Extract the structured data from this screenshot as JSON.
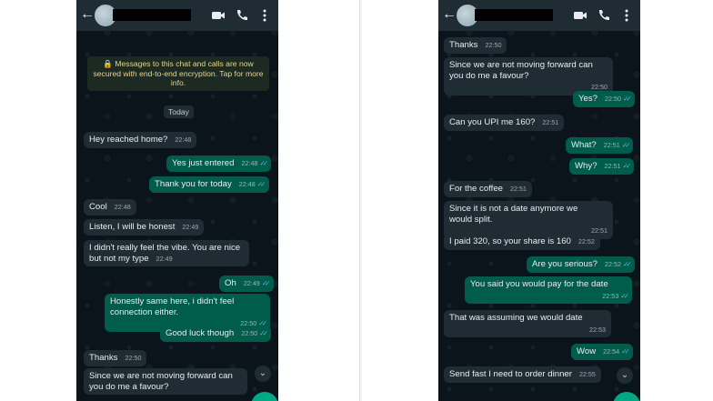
{
  "left": {
    "encryption_notice": "🔒 Messages to this chat and calls are now secured with end-to-end encryption. Tap for more info.",
    "date_label": "Today",
    "messages": [
      {
        "text": "Hey reached home?",
        "time": "22:48"
      },
      {
        "text": "Yes just entered",
        "time": "22:48"
      },
      {
        "text": "Thank you for today",
        "time": "22:48"
      },
      {
        "text": "Cool",
        "time": "22:48"
      },
      {
        "text": "Listen, I will be honest",
        "time": "22:49"
      },
      {
        "text": "I didn't really feel the vibe. You are nice\nbut not my type",
        "time": "22:49"
      },
      {
        "text": "Oh",
        "time": "22:49"
      },
      {
        "text": "Honestly same here, i didn't feel\nconnection either.",
        "time": "22:50"
      },
      {
        "text": "Good luck though",
        "time": "22:50"
      },
      {
        "text": "Thanks",
        "time": "22:50"
      },
      {
        "text": "Since we are not moving forward can\nyou do me a favour?",
        "time": ""
      }
    ]
  },
  "right": {
    "messages": [
      {
        "text": "Thanks",
        "time": "22:50"
      },
      {
        "text": "Since we are not moving forward can\nyou do me a favour?",
        "time": "22:50"
      },
      {
        "text": "Yes?",
        "time": "22:50"
      },
      {
        "text": "Can you UPI me 160?",
        "time": "22:51"
      },
      {
        "text": "What?",
        "time": "22:51"
      },
      {
        "text": "Why?",
        "time": "22:51"
      },
      {
        "text": "For the coffee",
        "time": "22:51"
      },
      {
        "text": "Since it is not a date anymore we\nwould split.",
        "time": "22:51"
      },
      {
        "text": "I paid 320, so your share is 160",
        "time": "22:52"
      },
      {
        "text": "Are you serious?",
        "time": "22:52"
      },
      {
        "text": "You said you would pay for the date",
        "time": "22:53"
      },
      {
        "text": "That was assuming we would date",
        "time": "22:53"
      },
      {
        "text": "Wow",
        "time": "22:54"
      },
      {
        "text": "Send fast I need to order dinner",
        "time": "22:55"
      }
    ]
  },
  "icons": {
    "back": "back-arrow-icon",
    "video": "video-call-icon",
    "call": "phone-icon",
    "more": "more-vertical-icon",
    "read": "double-check-icon",
    "scroll": "chevron-down-icon"
  },
  "colors": {
    "background": "#0b141a",
    "header": "#1f2c34",
    "incoming_bubble": "#1f2c34",
    "outgoing_bubble": "#005c4b",
    "read_ticks": "#53bdeb",
    "fab": "#00a884"
  }
}
